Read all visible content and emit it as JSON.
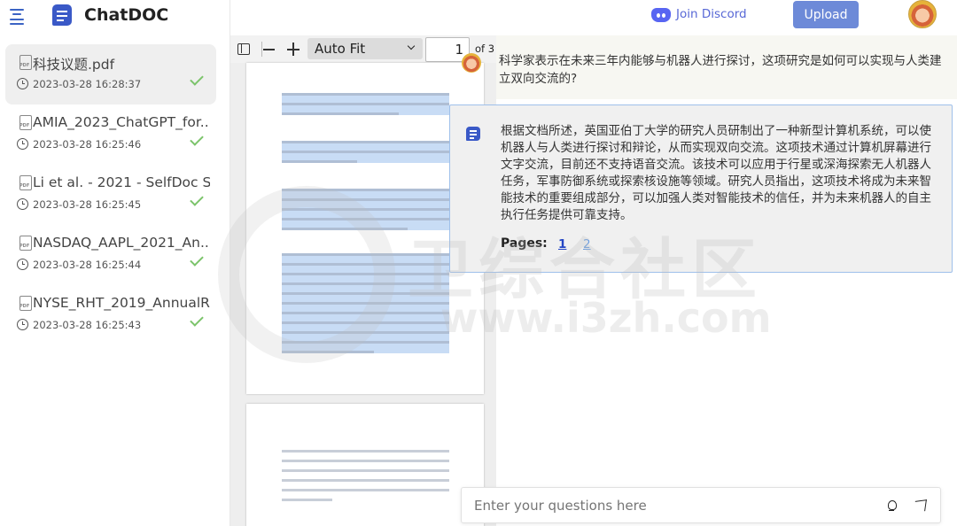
{
  "brand": {
    "name": "ChatDOC"
  },
  "header": {
    "discord_label": "Join Discord",
    "upload_label": "Upload"
  },
  "documents": [
    {
      "name": "科技议题.pdf",
      "time": "2023-03-28 16:28:37"
    },
    {
      "name": "AMIA_2023_ChatGPT_for...",
      "time": "2023-03-28 16:25:46"
    },
    {
      "name": "Li et al. - 2021 - SelfDoc S...",
      "time": "2023-03-28 16:25:45"
    },
    {
      "name": "NASDAQ_AAPL_2021_An...",
      "time": "2023-03-28 16:25:44"
    },
    {
      "name": "NYSE_RHT_2019_AnnualR...",
      "time": "2023-03-28 16:25:43"
    }
  ],
  "pdf_toolbar": {
    "zoom": "Auto Fit",
    "page": "1",
    "page_of": "of 3"
  },
  "chat": {
    "question": "科学家表示在未来三年内能够与机器人进行探讨，这项研究是如何可以实现与人类建立双向交流的?",
    "answer": "根据文档所述，英国亚伯丁大学的研究人员研制出了一种新型计算机系统，可以使机器人与人类进行探讨和辩论，从而实现双向交流。这项技术通过计算机屏幕进行文字交流，目前还不支持语音交流。该技术可以应用于行星或深海探索无人机器人任务，军事防御系统或探索核设施等领域。研究人员指出，这项技术将成为未来智能技术的重要组成部分，可以加强人类对智能技术的信任，并为未来机器人的自主执行任务提供可靠支持。",
    "pages_label": "Pages:",
    "page_links": [
      "1",
      "2"
    ],
    "input_placeholder": "Enter your questions here"
  },
  "watermark": {
    "text": "卫综合社区",
    "url": "www.i3zh.com"
  },
  "colors": {
    "accent": "#6d8ad8",
    "brand": "#3a59c7",
    "discord": "#5865f2",
    "check": "#7cc46b"
  }
}
